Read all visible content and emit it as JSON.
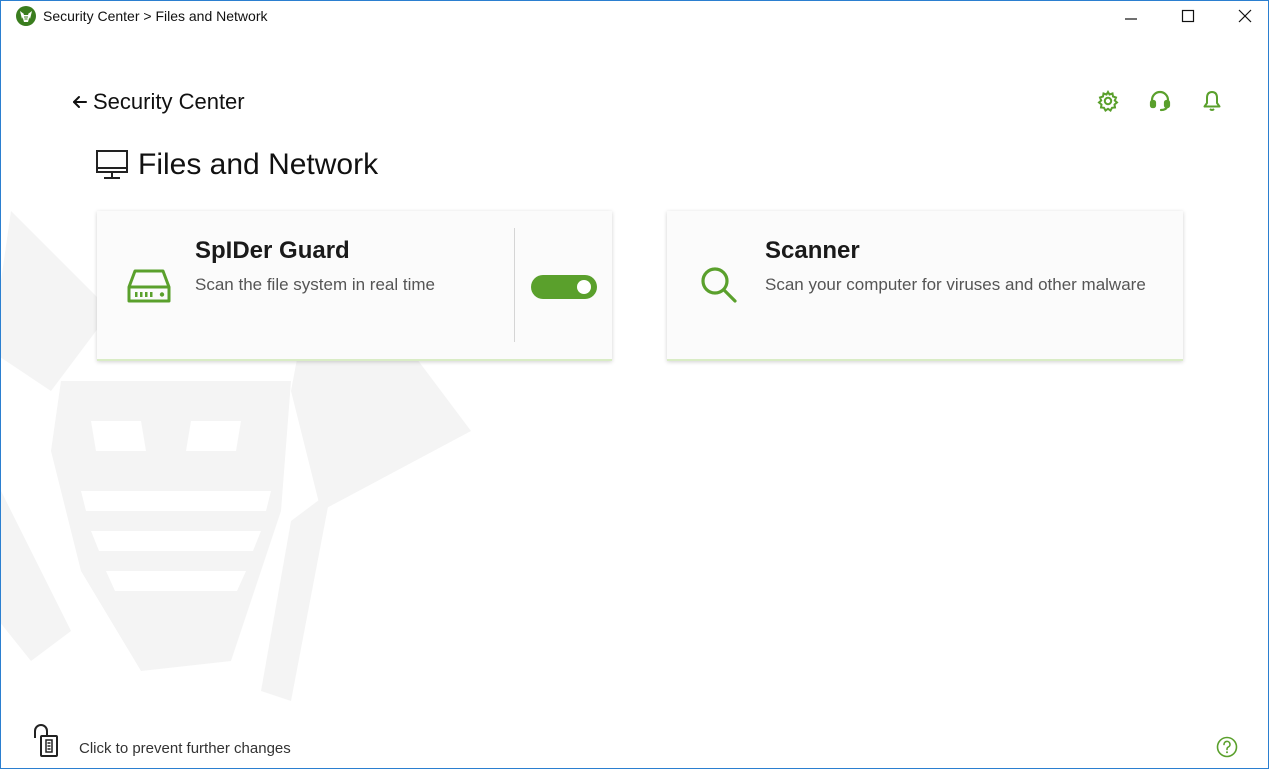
{
  "window": {
    "title": "Security Center > Files and Network"
  },
  "nav": {
    "back_label": "Security Center"
  },
  "page": {
    "title": "Files and Network"
  },
  "cards": [
    {
      "title": "SpIDer Guard",
      "description": "Scan the file system in real time",
      "icon": "hard-drive-icon",
      "toggle_on": true
    },
    {
      "title": "Scanner",
      "description": "Scan your computer for viruses and other malware",
      "icon": "magnifier-icon"
    }
  ],
  "footer": {
    "lock_text": "Click to prevent further changes",
    "help_icon": "help-icon"
  },
  "utility_icons": [
    "settings-gear-icon",
    "support-headset-icon",
    "notifications-bell-icon"
  ],
  "colors": {
    "accent": "#5aa02c",
    "border": "#2b7fd0"
  }
}
